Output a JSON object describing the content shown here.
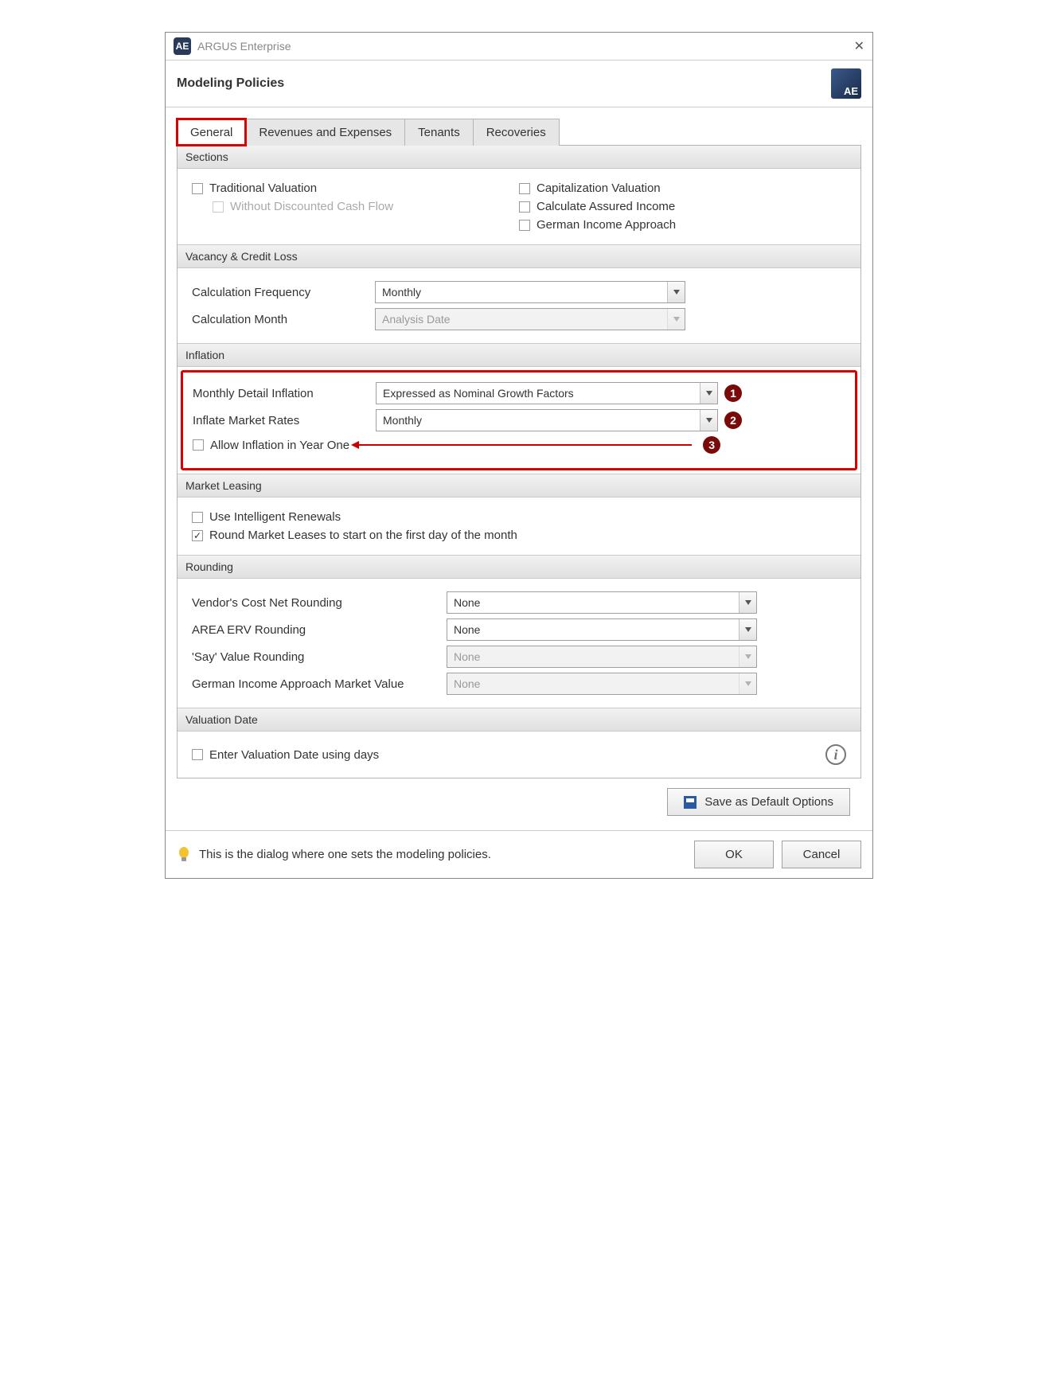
{
  "app": {
    "name": "ARGUS Enterprise",
    "icon_text": "AE"
  },
  "dialog": {
    "title": "Modeling Policies",
    "logo_text": "AE"
  },
  "tabs": [
    "General",
    "Revenues and Expenses",
    "Tenants",
    "Recoveries"
  ],
  "sections": {
    "sectionsGroup": {
      "title": "Sections",
      "traditional": "Traditional Valuation",
      "withoutDCF": "Without Discounted Cash Flow",
      "capitalization": "Capitalization Valuation",
      "assuredIncome": "Calculate Assured Income",
      "germanIncome": "German Income Approach"
    },
    "vacancy": {
      "title": "Vacancy & Credit Loss",
      "calcFreqLabel": "Calculation Frequency",
      "calcFreqValue": "Monthly",
      "calcMonthLabel": "Calculation Month",
      "calcMonthValue": "Analysis Date"
    },
    "inflation": {
      "title": "Inflation",
      "monthlyDetailLabel": "Monthly Detail Inflation",
      "monthlyDetailValue": "Expressed as Nominal Growth Factors",
      "inflateRatesLabel": "Inflate Market Rates",
      "inflateRatesValue": "Monthly",
      "allowYearOne": "Allow Inflation in Year One",
      "callouts": [
        "1",
        "2",
        "3"
      ]
    },
    "marketLeasing": {
      "title": "Market Leasing",
      "intelligentRenewals": "Use Intelligent Renewals",
      "roundLeases": "Round Market Leases to start on the first day of the month"
    },
    "rounding": {
      "title": "Rounding",
      "vendorLabel": "Vendor's Cost Net Rounding",
      "vendorValue": "None",
      "areaERVLabel": "AREA ERV Rounding",
      "areaERVValue": "None",
      "sayLabel": "'Say' Value Rounding",
      "sayValue": "None",
      "germanMVLabel": "German Income Approach Market Value",
      "germanMVValue": "None"
    },
    "valuationDate": {
      "title": "Valuation Date",
      "enterDays": "Enter Valuation Date using days"
    }
  },
  "buttons": {
    "saveDefault": "Save as Default Options",
    "ok": "OK",
    "cancel": "Cancel"
  },
  "hint": "This is the dialog where one sets the modeling policies."
}
